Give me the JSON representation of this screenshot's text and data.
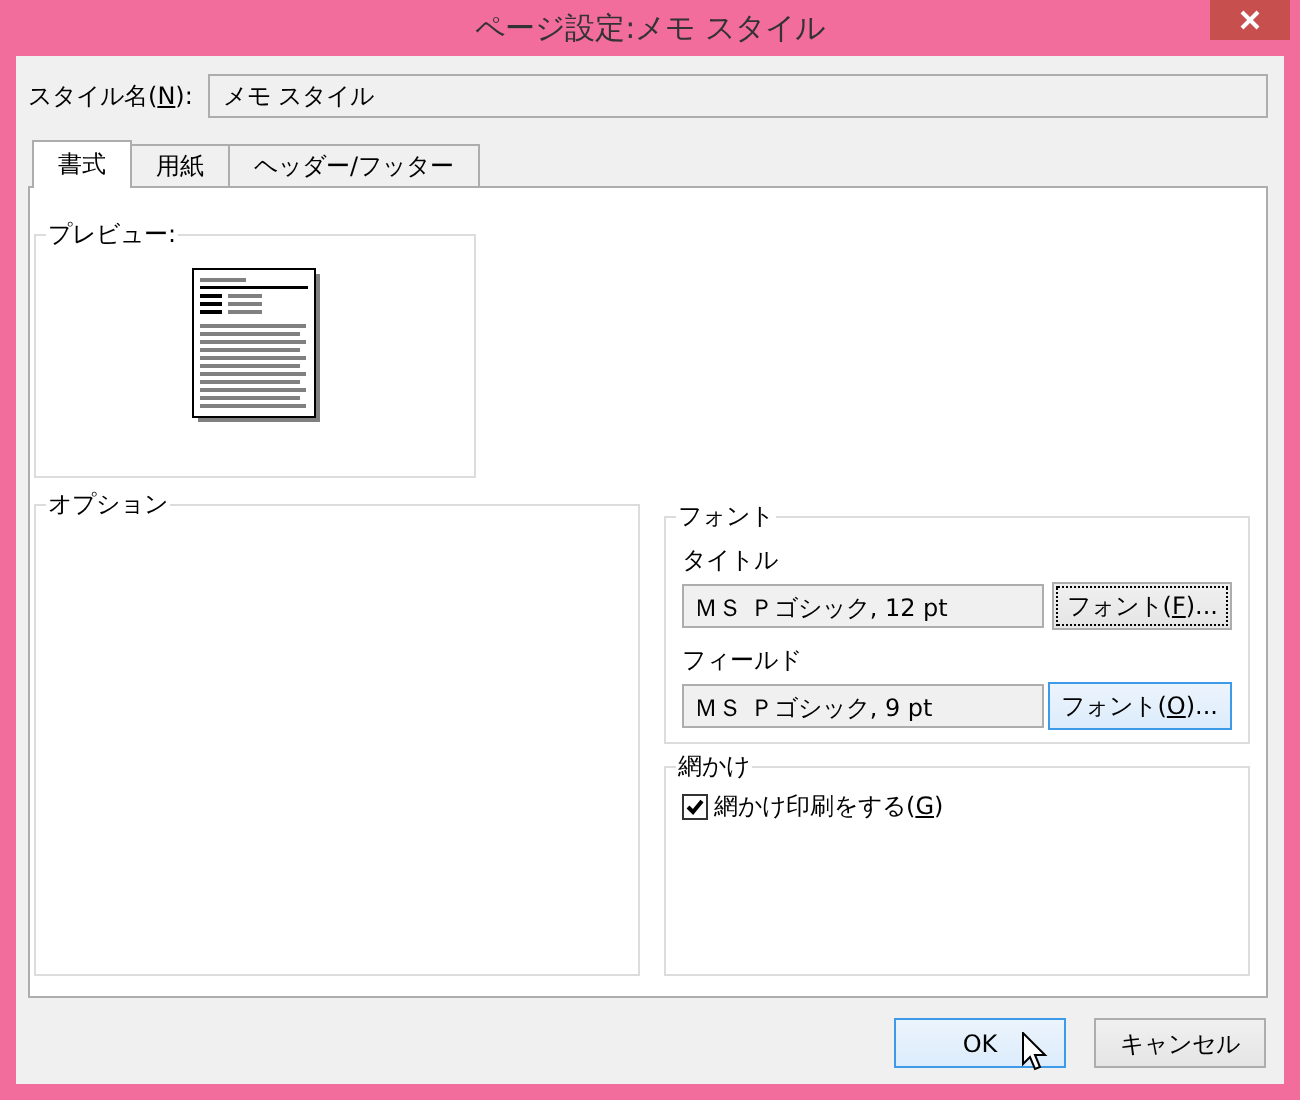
{
  "window": {
    "title": "ページ設定:メモ スタイル"
  },
  "style_name": {
    "label_parts": [
      "スタイル名(",
      "N",
      "):"
    ],
    "value": "メモ スタイル"
  },
  "tabs": [
    {
      "label": "書式",
      "selected": true
    },
    {
      "label": "用紙",
      "selected": false
    },
    {
      "label": "ヘッダー/フッター",
      "selected": false
    }
  ],
  "preview": {
    "legend": "プレビュー:"
  },
  "options": {
    "legend": "オプション"
  },
  "font": {
    "legend": "フォント",
    "rows": [
      {
        "label": "タイトル",
        "value": "ＭＳ Ｐゴシック, 12 pt",
        "button_parts": [
          "フォント(",
          "F",
          ")..."
        ],
        "focused": true,
        "hot": false
      },
      {
        "label": "フィールド",
        "value": "ＭＳ Ｐゴシック, 9 pt",
        "button_parts": [
          "フォント(",
          "O",
          ")..."
        ],
        "focused": false,
        "hot": true
      }
    ]
  },
  "shading": {
    "legend": "網かけ",
    "checkbox": {
      "label_parts": [
        "網かけ印刷をする(",
        "G",
        ")"
      ],
      "checked": true
    }
  },
  "buttons": [
    {
      "label": "OK",
      "hot": true
    },
    {
      "label": "キャンセル",
      "hot": false
    }
  ]
}
